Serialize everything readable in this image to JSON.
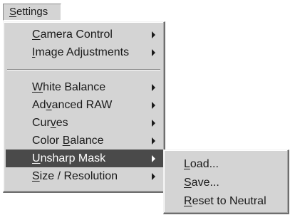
{
  "menubar": {
    "settings_label": "Settings"
  },
  "main_menu": {
    "items": [
      {
        "label": "Camera Control",
        "mnemonic": "C"
      },
      {
        "label": "Image Adjustments",
        "mnemonic": "I"
      },
      {
        "label": "White Balance",
        "mnemonic": "W"
      },
      {
        "label": "Advanced RAW",
        "mnemonic": "v"
      },
      {
        "label": "Curves",
        "mnemonic": "v"
      },
      {
        "label": "Color Balance",
        "mnemonic": "B"
      },
      {
        "label": "Unsharp Mask",
        "mnemonic": "U"
      },
      {
        "label": "Size / Resolution",
        "mnemonic": "S"
      }
    ],
    "active_item": "Unsharp Mask"
  },
  "sub_menu": {
    "items": [
      {
        "label": "Load...",
        "mnemonic": "L"
      },
      {
        "label": "Save...",
        "mnemonic": "S"
      },
      {
        "label": "Reset to Neutral",
        "mnemonic": "R"
      }
    ]
  },
  "icons": [
    "submenu-arrow-icon"
  ],
  "colors": {
    "menu_bg": "#d4d4d4",
    "highlight_bg": "#4a4a4a",
    "highlight_text": "#ffffff"
  }
}
